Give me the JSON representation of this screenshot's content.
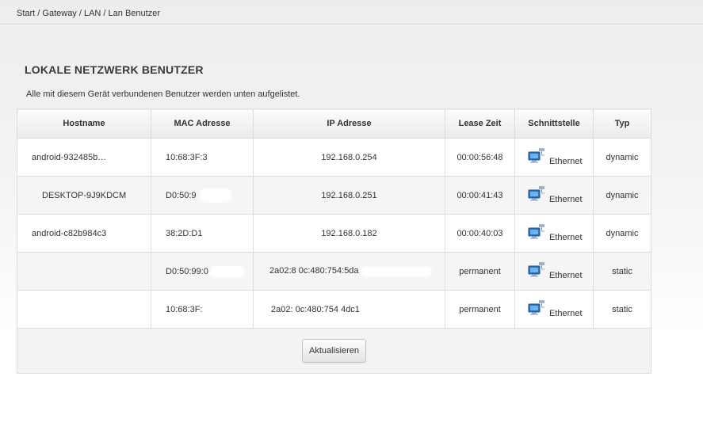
{
  "breadcrumb": "Start / Gateway / LAN / Lan Benutzer",
  "page_title": "LOKALE NETZWERK BENUTZER",
  "description": "Alle mit diesem Gerät verbundenen Benutzer werden unten aufgelistet.",
  "table": {
    "headers": {
      "hostname": "Hostname",
      "mac": "MAC Adresse",
      "ip": "IP Adresse",
      "lease": "Lease Zeit",
      "interface": "Schnittstelle",
      "type": "Typ"
    },
    "rows": [
      {
        "hostname": "android-932485b…",
        "mac": "10:68:3F:3",
        "ip": "192.168.0.254",
        "lease": "00:00:56:48",
        "interface": "Ethernet",
        "type": "dynamic"
      },
      {
        "hostname": "DESKTOP-9J9KDCM",
        "mac": "D0:50:9",
        "ip": "192.168.0.251",
        "lease": "00:00:41:43",
        "interface": "Ethernet",
        "type": "dynamic"
      },
      {
        "hostname": "android-c82b984c3",
        "mac": "38:2D:D1",
        "ip": "192.168.0.182",
        "lease": "00:00:40:03",
        "interface": "Ethernet",
        "type": "dynamic"
      },
      {
        "hostname": "",
        "mac": "D0:50:99:0",
        "ip": "2a02:8  0c:480:754:5da",
        "lease": "permanent",
        "interface": "Ethernet",
        "type": "static"
      },
      {
        "hostname": "",
        "mac": "10:68:3F:",
        "ip": "2a02:  0c:480:754   4dc1",
        "lease": "permanent",
        "interface": "Ethernet",
        "type": "static"
      }
    ]
  },
  "refresh_button": "Aktualisieren",
  "icons": {
    "interface": "network-computer-icon"
  },
  "colors": {
    "border": "#dcdcdc",
    "header_bg": "#ebebeb",
    "row_alt_bg": "#f5f5f5",
    "text": "#333333"
  }
}
